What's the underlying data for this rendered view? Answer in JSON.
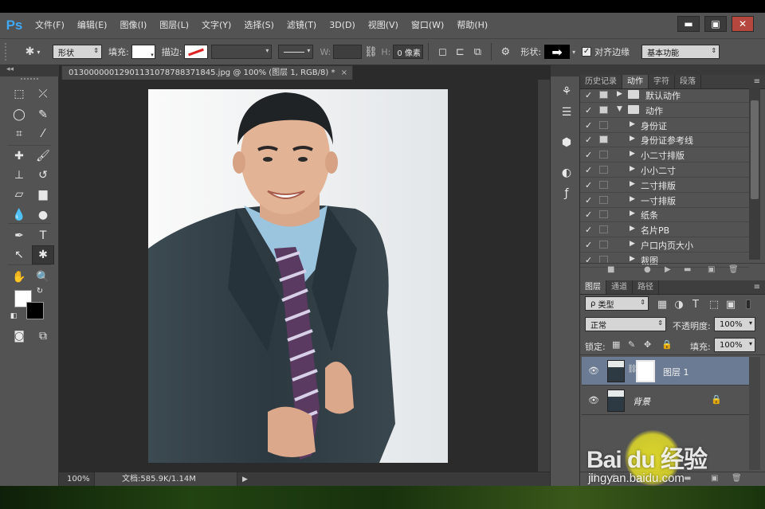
{
  "app": {
    "logo": "Ps"
  },
  "menu": [
    "文件(F)",
    "编辑(E)",
    "图像(I)",
    "图层(L)",
    "文字(Y)",
    "选择(S)",
    "滤镜(T)",
    "3D(D)",
    "视图(V)",
    "窗口(W)",
    "帮助(H)"
  ],
  "window_controls": {
    "minimize": "▬",
    "maximize": "▣",
    "close": "✕"
  },
  "options_bar": {
    "tool_mode": "形状",
    "fill_label": "填充:",
    "stroke_label": "描边:",
    "w_label": "W:",
    "h_label": "H:",
    "h_value": "0 像素",
    "shape_label": "形状:",
    "align_edges_label": "对齐边缘",
    "workspace": "基本功能"
  },
  "document": {
    "tab_title": "0130000001290113107878837184​5.jpg @ 100% (图层 1, RGB/8) *",
    "zoom": "100%",
    "doc_info": "文档:585.9K/1.14M"
  },
  "actions_panel": {
    "tabs": [
      "历史记录",
      "动作",
      "字符",
      "段落"
    ],
    "active_tab": "动作",
    "items": [
      {
        "label": "默认动作",
        "level": 0,
        "folder": true,
        "expanded": false,
        "dialog": true
      },
      {
        "label": "动作",
        "level": 0,
        "folder": true,
        "expanded": true,
        "dialog": true
      },
      {
        "label": "身份证",
        "level": 1,
        "folder": false,
        "dialog": false
      },
      {
        "label": "身份证参考线",
        "level": 1,
        "folder": false,
        "dialog": true
      },
      {
        "label": "小二寸排版",
        "level": 1,
        "folder": false,
        "dialog": false
      },
      {
        "label": "小小二寸",
        "level": 1,
        "folder": false,
        "dialog": false
      },
      {
        "label": "二寸排版",
        "level": 1,
        "folder": false,
        "dialog": false
      },
      {
        "label": "一寸排版",
        "level": 1,
        "folder": false,
        "dialog": false
      },
      {
        "label": "纸条",
        "level": 1,
        "folder": false,
        "dialog": false
      },
      {
        "label": "名片PB",
        "level": 1,
        "folder": false,
        "dialog": false
      },
      {
        "label": "户口内页大小",
        "level": 1,
        "folder": false,
        "dialog": false
      },
      {
        "label": "裁图",
        "level": 1,
        "folder": false,
        "dialog": false
      }
    ]
  },
  "layers_panel": {
    "tabs": [
      "图层",
      "通道",
      "路径"
    ],
    "active_tab": "图层",
    "filter_label": "类型",
    "blend_mode": "正常",
    "opacity_label": "不透明度:",
    "opacity_value": "100%",
    "lock_label": "锁定:",
    "fill_label": "填充:",
    "fill_value": "100%",
    "layers": [
      {
        "name": "图层 1",
        "selected": true,
        "has_mask": true,
        "locked": false
      },
      {
        "name": "背景",
        "selected": false,
        "has_mask": false,
        "locked": true,
        "italic": true
      }
    ]
  },
  "watermark": {
    "brand": "Bai du 经验",
    "url": "jingyan.baidu.com"
  }
}
